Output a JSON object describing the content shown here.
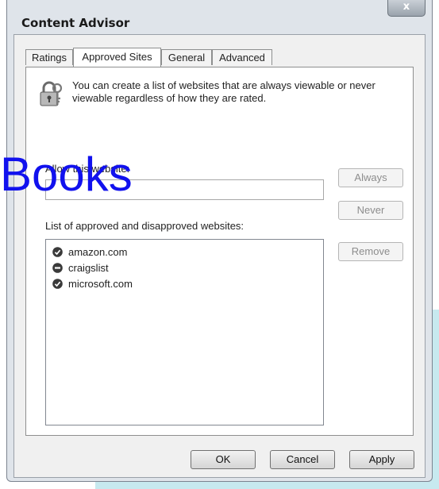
{
  "window": {
    "title": "Content Advisor",
    "close_glyph": "x"
  },
  "tabs": [
    {
      "label": "Ratings",
      "active": false
    },
    {
      "label": "Approved Sites",
      "active": true
    },
    {
      "label": "General",
      "active": false
    },
    {
      "label": "Advanced",
      "active": false
    }
  ],
  "panel": {
    "info": "You can create a list of websites that are always viewable or never viewable regardless of how they are rated.",
    "allow_label": "Allow this website:",
    "website_value": "",
    "list_label": "List of approved and disapproved websites:",
    "sites": [
      {
        "name": "amazon.com",
        "status": "approved",
        "icon": "check-circle-icon"
      },
      {
        "name": "craigslist",
        "status": "disapproved",
        "icon": "minus-circle-icon"
      },
      {
        "name": "microsoft.com",
        "status": "approved",
        "icon": "check-circle-icon"
      }
    ],
    "buttons": {
      "always": "Always",
      "never": "Never",
      "remove": "Remove"
    }
  },
  "footer": {
    "ok": "OK",
    "cancel": "Cancel",
    "apply": "Apply"
  },
  "watermark": {
    "text": "Books",
    "color": "#1111ee"
  },
  "colors": {
    "background_accent": "#c7e9ef",
    "disabled_text": "#8d8d8d"
  }
}
